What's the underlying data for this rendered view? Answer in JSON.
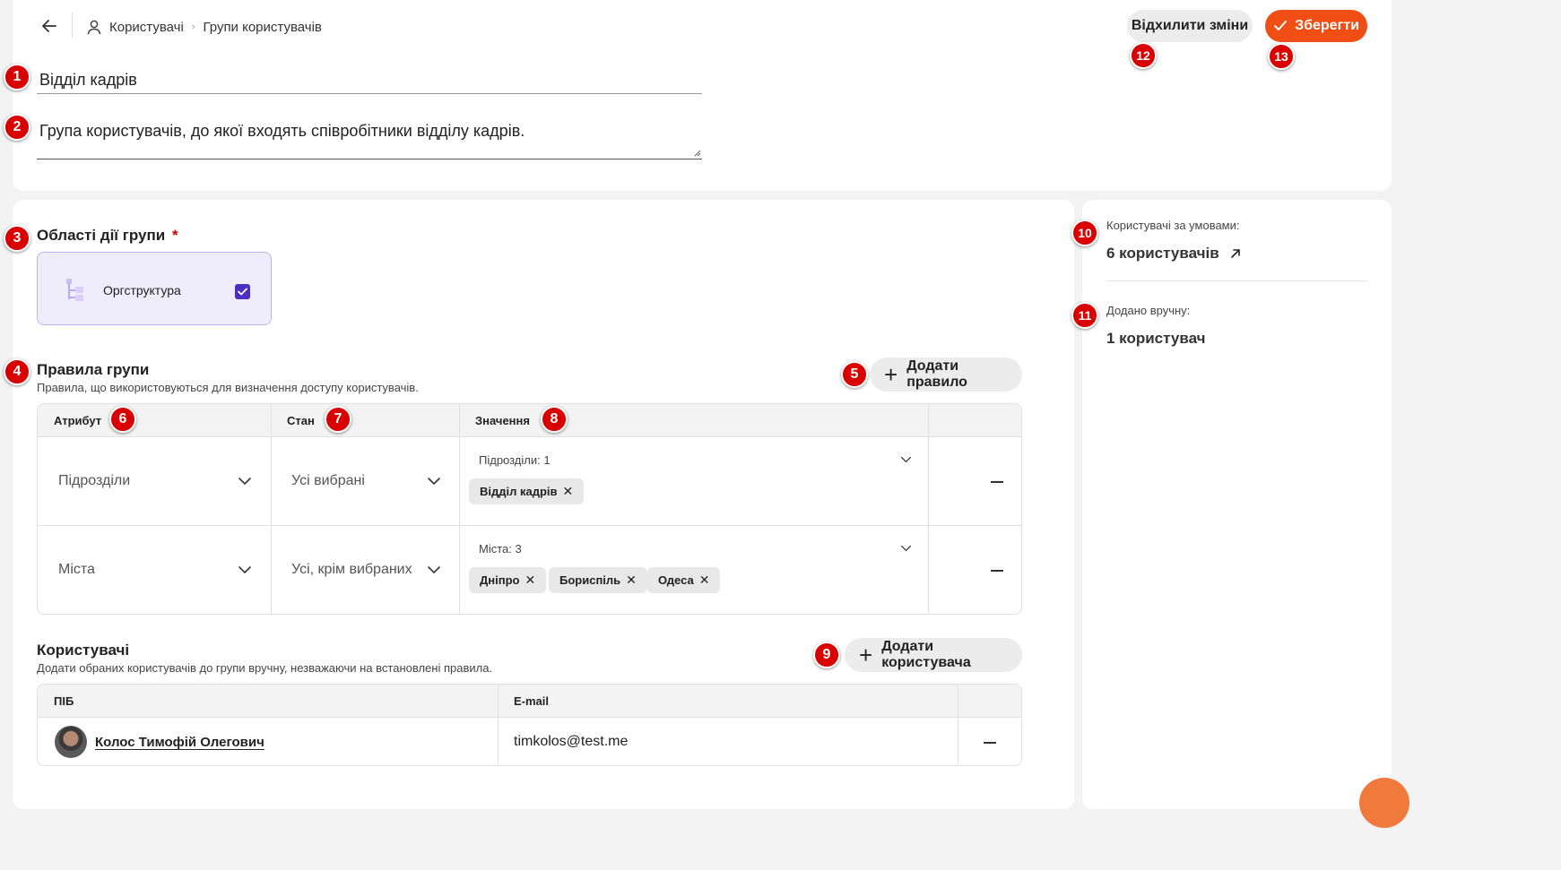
{
  "header": {
    "breadcrumb": [
      "Користувачі",
      "Групи користувачів"
    ],
    "discard_label": "Відхилити зміни",
    "save_label": "Зберегти"
  },
  "group": {
    "name": "Відділ кадрів",
    "description": "Група користувачів, до якої входять співробітники відділу кадрів."
  },
  "scopes": {
    "title": "Області дії групи",
    "required_mark": "*",
    "option_label": "Оргструктура",
    "option_checked": true
  },
  "rules": {
    "title": "Правила групи",
    "subtitle": "Правила, що використовуються для визначення доступу користувачів.",
    "add_label": "Додати правило",
    "columns": [
      "Атрибут",
      "Стан",
      "Значення"
    ],
    "rows": [
      {
        "attribute": "Підрозділи",
        "state": "Усі вибрані",
        "values_label": "Підрозділи: 1",
        "chips": [
          "Відділ кадрів"
        ]
      },
      {
        "attribute": "Міста",
        "state": "Усі, крім вибраних",
        "values_label": "Міста: 3",
        "chips": [
          "Дніпро",
          "Бориспіль",
          "Одеса"
        ]
      }
    ]
  },
  "users": {
    "title": "Користувачі",
    "subtitle": "Додати обраних користувачів до групи вручну, незважаючи на встановлені правила.",
    "add_label": "Додати користувача",
    "columns": [
      "ПІБ",
      "E-mail"
    ],
    "rows": [
      {
        "name": "Колос Тимофій Олегович",
        "email": "timkolos@test.me"
      }
    ]
  },
  "summary": {
    "conditional_label": "Користувачі за умовами:",
    "conditional_value": "6 користувачів",
    "manual_label": "Додано вручну:",
    "manual_value": "1 користувач"
  },
  "badges": [
    "1",
    "2",
    "3",
    "4",
    "5",
    "6",
    "7",
    "8",
    "9",
    "10",
    "11",
    "12",
    "13"
  ],
  "colors": {
    "accent": "#f04e14",
    "badge": "#d90000",
    "checkbox": "#4b2fc2",
    "scope_card_bg": "#efedfc",
    "scope_card_border": "#bdb4ee"
  },
  "icons": [
    "back-arrow-icon",
    "user-icon",
    "chevron-right-icon",
    "check-icon",
    "plus-icon",
    "chevron-down-icon",
    "close-icon",
    "minus-icon",
    "external-arrow-icon",
    "orgstructure-icon"
  ]
}
